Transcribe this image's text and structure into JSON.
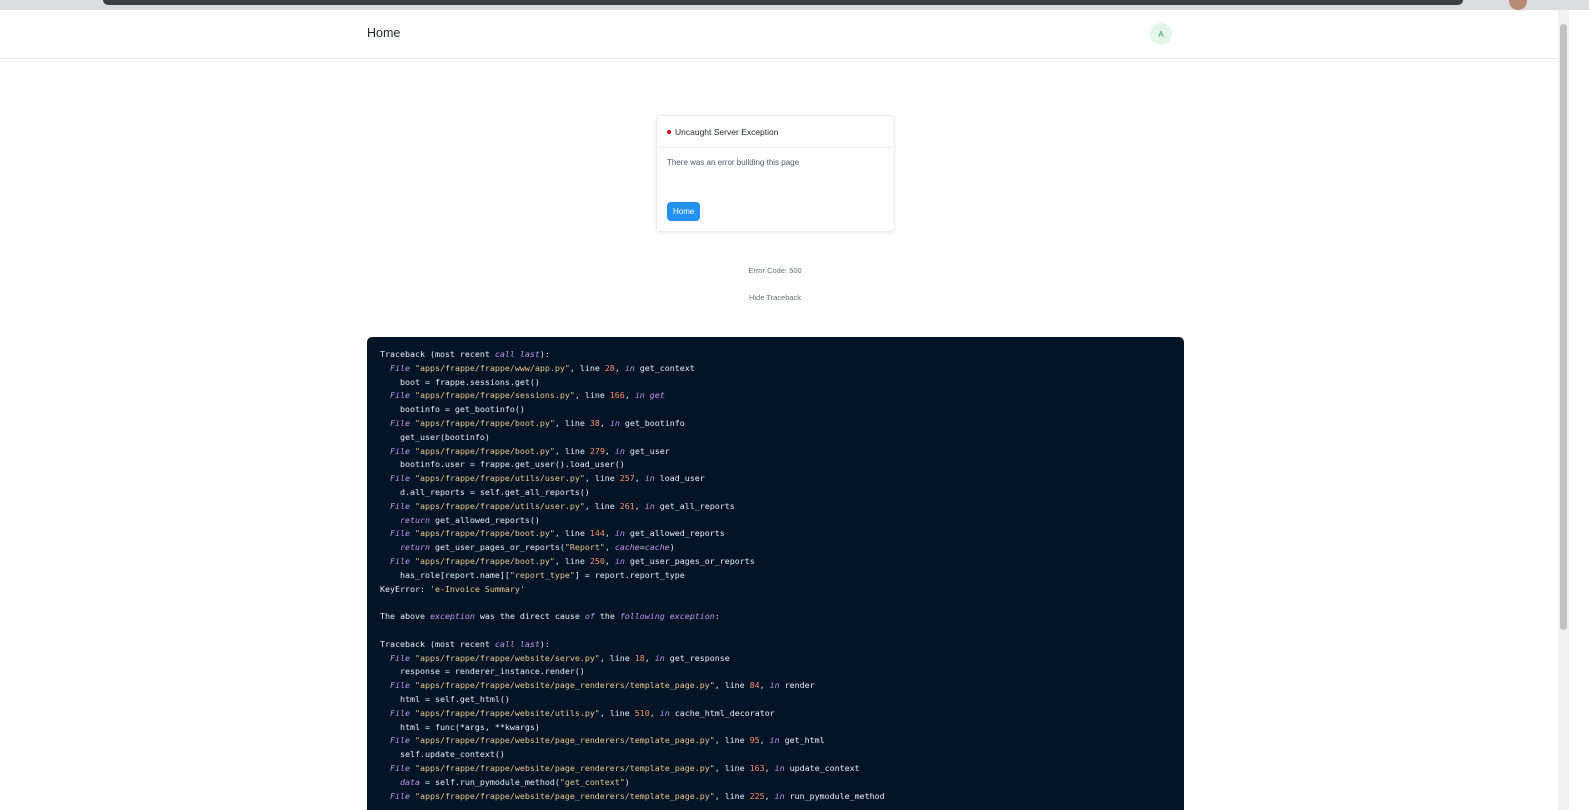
{
  "navbar": {
    "brand": "Home",
    "avatar_initial": "A"
  },
  "error_card": {
    "title": "Uncaught Server Exception",
    "message": "There was an error building this page",
    "home_button": "Home"
  },
  "error_code_text": "Error Code: 500",
  "toggle_traceback": "Hide Traceback",
  "traceback_lines": [
    [
      {
        "t": "Traceback (most recent "
      },
      {
        "t": "call",
        "c": "kw"
      },
      {
        "t": " "
      },
      {
        "t": "last",
        "c": "kw"
      },
      {
        "t": "):"
      }
    ],
    [
      {
        "t": "  "
      },
      {
        "t": "File",
        "c": "kw"
      },
      {
        "t": " "
      },
      {
        "t": "\"apps/frappe/frappe/www/app.py\"",
        "c": "str"
      },
      {
        "t": ", line "
      },
      {
        "t": "28",
        "c": "num"
      },
      {
        "t": ", "
      },
      {
        "t": "in",
        "c": "kw"
      },
      {
        "t": " get_context"
      }
    ],
    [
      {
        "t": "    boot = frappe.sessions.get()"
      }
    ],
    [
      {
        "t": "  "
      },
      {
        "t": "File",
        "c": "kw"
      },
      {
        "t": " "
      },
      {
        "t": "\"apps/frappe/frappe/sessions.py\"",
        "c": "str"
      },
      {
        "t": ", line "
      },
      {
        "t": "166",
        "c": "num"
      },
      {
        "t": ", "
      },
      {
        "t": "in get",
        "c": "kw"
      }
    ],
    [
      {
        "t": "    bootinfo = get_bootinfo()"
      }
    ],
    [
      {
        "t": "  "
      },
      {
        "t": "File",
        "c": "kw"
      },
      {
        "t": " "
      },
      {
        "t": "\"apps/frappe/frappe/boot.py\"",
        "c": "str"
      },
      {
        "t": ", line "
      },
      {
        "t": "38",
        "c": "num"
      },
      {
        "t": ", "
      },
      {
        "t": "in",
        "c": "kw"
      },
      {
        "t": " get_bootinfo"
      }
    ],
    [
      {
        "t": "    get_user(bootinfo)"
      }
    ],
    [
      {
        "t": "  "
      },
      {
        "t": "File",
        "c": "kw"
      },
      {
        "t": " "
      },
      {
        "t": "\"apps/frappe/frappe/boot.py\"",
        "c": "str"
      },
      {
        "t": ", line "
      },
      {
        "t": "279",
        "c": "num"
      },
      {
        "t": ", "
      },
      {
        "t": "in",
        "c": "kw"
      },
      {
        "t": " get_user"
      }
    ],
    [
      {
        "t": "    bootinfo.user = frappe.get_user().load_user()"
      }
    ],
    [
      {
        "t": "  "
      },
      {
        "t": "File",
        "c": "kw"
      },
      {
        "t": " "
      },
      {
        "t": "\"apps/frappe/frappe/utils/user.py\"",
        "c": "str"
      },
      {
        "t": ", line "
      },
      {
        "t": "257",
        "c": "num"
      },
      {
        "t": ", "
      },
      {
        "t": "in",
        "c": "kw"
      },
      {
        "t": " load_user"
      }
    ],
    [
      {
        "t": "    d.all_reports = self.get_all_reports()"
      }
    ],
    [
      {
        "t": "  "
      },
      {
        "t": "File",
        "c": "kw"
      },
      {
        "t": " "
      },
      {
        "t": "\"apps/frappe/frappe/utils/user.py\"",
        "c": "str"
      },
      {
        "t": ", line "
      },
      {
        "t": "261",
        "c": "num"
      },
      {
        "t": ", "
      },
      {
        "t": "in",
        "c": "kw"
      },
      {
        "t": " get_all_reports"
      }
    ],
    [
      {
        "t": "    "
      },
      {
        "t": "return",
        "c": "kw"
      },
      {
        "t": " get_allowed_reports()"
      }
    ],
    [
      {
        "t": "  "
      },
      {
        "t": "File",
        "c": "kw"
      },
      {
        "t": " "
      },
      {
        "t": "\"apps/frappe/frappe/boot.py\"",
        "c": "str"
      },
      {
        "t": ", line "
      },
      {
        "t": "144",
        "c": "num"
      },
      {
        "t": ", "
      },
      {
        "t": "in",
        "c": "kw"
      },
      {
        "t": " get_allowed_reports"
      }
    ],
    [
      {
        "t": "    "
      },
      {
        "t": "return",
        "c": "kw"
      },
      {
        "t": " get_user_pages_or_reports("
      },
      {
        "t": "\"Report\"",
        "c": "str"
      },
      {
        "t": ", "
      },
      {
        "t": "cache",
        "c": "kw"
      },
      {
        "t": "="
      },
      {
        "t": "cache",
        "c": "kw"
      },
      {
        "t": ")"
      }
    ],
    [
      {
        "t": "  "
      },
      {
        "t": "File",
        "c": "kw"
      },
      {
        "t": " "
      },
      {
        "t": "\"apps/frappe/frappe/boot.py\"",
        "c": "str"
      },
      {
        "t": ", line "
      },
      {
        "t": "250",
        "c": "num"
      },
      {
        "t": ", "
      },
      {
        "t": "in",
        "c": "kw"
      },
      {
        "t": " get_user_pages_or_reports"
      }
    ],
    [
      {
        "t": "    has_role[report.name]["
      },
      {
        "t": "\"report_type\"",
        "c": "str"
      },
      {
        "t": "] = report.report_type"
      }
    ],
    [
      {
        "t": "KeyError: "
      },
      {
        "t": "'e-Invoice Summary'",
        "c": "str"
      }
    ],
    [
      {
        "t": ""
      }
    ],
    [
      {
        "t": "The above "
      },
      {
        "t": "exception",
        "c": "kw"
      },
      {
        "t": " was the direct cause "
      },
      {
        "t": "of",
        "c": "kw"
      },
      {
        "t": " the "
      },
      {
        "t": "following",
        "c": "kw"
      },
      {
        "t": " "
      },
      {
        "t": "exception",
        "c": "kw"
      },
      {
        "t": ":"
      }
    ],
    [
      {
        "t": ""
      }
    ],
    [
      {
        "t": "Traceback (most recent "
      },
      {
        "t": "call",
        "c": "kw"
      },
      {
        "t": " "
      },
      {
        "t": "last",
        "c": "kw"
      },
      {
        "t": "):"
      }
    ],
    [
      {
        "t": "  "
      },
      {
        "t": "File",
        "c": "kw"
      },
      {
        "t": " "
      },
      {
        "t": "\"apps/frappe/frappe/website/serve.py\"",
        "c": "str"
      },
      {
        "t": ", line "
      },
      {
        "t": "18",
        "c": "num"
      },
      {
        "t": ", "
      },
      {
        "t": "in",
        "c": "kw"
      },
      {
        "t": " get_response"
      }
    ],
    [
      {
        "t": "    response = renderer_instance.render()"
      }
    ],
    [
      {
        "t": "  "
      },
      {
        "t": "File",
        "c": "kw"
      },
      {
        "t": " "
      },
      {
        "t": "\"apps/frappe/frappe/website/page_renderers/template_page.py\"",
        "c": "str"
      },
      {
        "t": ", line "
      },
      {
        "t": "84",
        "c": "num"
      },
      {
        "t": ", "
      },
      {
        "t": "in",
        "c": "kw"
      },
      {
        "t": " render"
      }
    ],
    [
      {
        "t": "    html = self.get_html()"
      }
    ],
    [
      {
        "t": "  "
      },
      {
        "t": "File",
        "c": "kw"
      },
      {
        "t": " "
      },
      {
        "t": "\"apps/frappe/frappe/website/utils.py\"",
        "c": "str"
      },
      {
        "t": ", line "
      },
      {
        "t": "510",
        "c": "num"
      },
      {
        "t": ", "
      },
      {
        "t": "in",
        "c": "kw"
      },
      {
        "t": " cache_html_decorator"
      }
    ],
    [
      {
        "t": "    html = func(*args, **kwargs)"
      }
    ],
    [
      {
        "t": "  "
      },
      {
        "t": "File",
        "c": "kw"
      },
      {
        "t": " "
      },
      {
        "t": "\"apps/frappe/frappe/website/page_renderers/template_page.py\"",
        "c": "str"
      },
      {
        "t": ", line "
      },
      {
        "t": "95",
        "c": "num"
      },
      {
        "t": ", "
      },
      {
        "t": "in",
        "c": "kw"
      },
      {
        "t": " get_html"
      }
    ],
    [
      {
        "t": "    self.update_context()"
      }
    ],
    [
      {
        "t": "  "
      },
      {
        "t": "File",
        "c": "kw"
      },
      {
        "t": " "
      },
      {
        "t": "\"apps/frappe/frappe/website/page_renderers/template_page.py\"",
        "c": "str"
      },
      {
        "t": ", line "
      },
      {
        "t": "163",
        "c": "num"
      },
      {
        "t": ", "
      },
      {
        "t": "in",
        "c": "kw"
      },
      {
        "t": " update_context"
      }
    ],
    [
      {
        "t": "    "
      },
      {
        "t": "data",
        "c": "kw"
      },
      {
        "t": " = self.run_pymodule_method("
      },
      {
        "t": "\"get_context\"",
        "c": "str"
      },
      {
        "t": ")"
      }
    ],
    [
      {
        "t": "  "
      },
      {
        "t": "File",
        "c": "kw"
      },
      {
        "t": " "
      },
      {
        "t": "\"apps/frappe/frappe/website/page_renderers/template_page.py\"",
        "c": "str"
      },
      {
        "t": ", line "
      },
      {
        "t": "225",
        "c": "num"
      },
      {
        "t": ", "
      },
      {
        "t": "in",
        "c": "kw"
      },
      {
        "t": " run_pymodule_method"
      }
    ]
  ]
}
